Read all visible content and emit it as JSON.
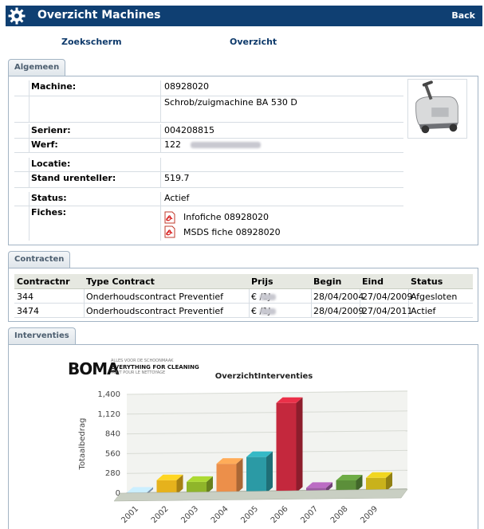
{
  "header": {
    "title": "Overzicht Machines",
    "back_label": "Back"
  },
  "nav": {
    "zoekscherm": "Zoekscherm",
    "overzicht": "Overzicht"
  },
  "tabs": {
    "algemeen": "Algemeen",
    "contracten": "Contracten",
    "interventies": "Interventies"
  },
  "algemeen": {
    "machine_label": "Machine:",
    "machine_number": "08928020",
    "machine_desc": "Schrob/zuigmachine BA 530 D",
    "serienr_label": "Serienr:",
    "serienr": "004208815",
    "werf_label": "Werf:",
    "werf": "122",
    "locatie_label": "Locatie:",
    "locatie": "",
    "urenteller_label": "Stand urenteller:",
    "urenteller": "519.7",
    "status_label": "Status:",
    "status": "Actief",
    "fiches_label": "Fiches:",
    "fiches": [
      "Infofiche 08928020",
      "MSDS fiche 08928020"
    ]
  },
  "contracten": {
    "headers": [
      "Contractnr",
      "Type Contract",
      "Prijs",
      "Begin",
      "Eind",
      "Status"
    ],
    "rows": [
      {
        "nr": "344",
        "type": "Onderhoudscontract Preventief",
        "currency": "€",
        "period": "/1J",
        "begin": "28/04/2004",
        "eind": "27/04/2009",
        "status": "Afgesloten"
      },
      {
        "nr": "3474",
        "type": "Onderhoudscontract Preventief",
        "currency": "€",
        "period": "/1J",
        "begin": "28/04/2009",
        "eind": "27/04/2011",
        "status": "Actief"
      }
    ]
  },
  "logo": {
    "brand": "BOMA",
    "tagline": "EVERYTHING FOR CLEANING",
    "sub1": "ALLES VOOR DE SCHOONMAAK",
    "sub2": "TOUT POUR LE NETTOYAGE"
  },
  "chart_data": {
    "type": "bar",
    "title": "OverzichtInterventies",
    "ylabel": "Totaalbedrag",
    "xlabel": "",
    "categories": [
      "2001",
      "2002",
      "2003",
      "2004",
      "2005",
      "2006",
      "2007",
      "2008",
      "2009"
    ],
    "values": [
      30,
      200,
      170,
      420,
      510,
      1270,
      60,
      160,
      190
    ],
    "yticks": [
      "0",
      "280",
      "560",
      "840",
      "1,120",
      "1,400"
    ],
    "ylim": [
      0,
      1400
    ],
    "colors": [
      "#a9c7e8",
      "#e6b21c",
      "#8fb52a",
      "#ec8f4a",
      "#2b9aa5",
      "#c4283d",
      "#9c5aa3",
      "#5c8f3a",
      "#c9b21b"
    ],
    "grid": true,
    "legend": "none"
  }
}
